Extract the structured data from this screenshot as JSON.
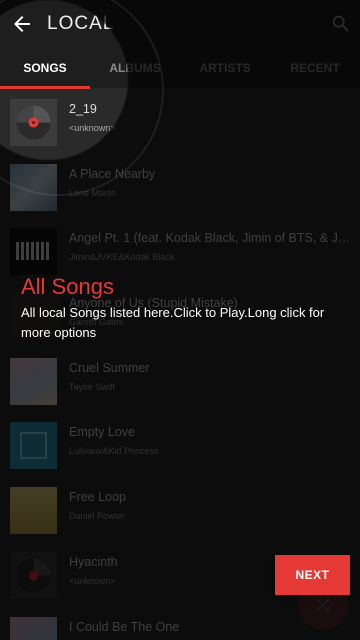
{
  "header": {
    "title": "LOCAL"
  },
  "tabs": [
    {
      "label": "SONGS"
    },
    {
      "label": "ALBUMS"
    },
    {
      "label": "ARTISTS"
    },
    {
      "label": "RECENT"
    }
  ],
  "songs": [
    {
      "title": "2_19",
      "artist": "<unknown>"
    },
    {
      "title": "A Place Nearby",
      "artist": "Lene Marlin"
    },
    {
      "title": "Angel Pt. 1 (feat. Kodak Black, Jimin of BTS, & JVKE...",
      "artist": "Jimin&JVKE&Kodak Black"
    },
    {
      "title": "Anyone of Us (Stupid Mistake)",
      "artist": "Gareth Gates"
    },
    {
      "title": "Cruel Summer",
      "artist": "Taylor Swift"
    },
    {
      "title": "Empty Love",
      "artist": "Lulleaux&Kid Princess"
    },
    {
      "title": "Free Loop",
      "artist": "Daniel Powter"
    },
    {
      "title": "Hyacinth",
      "artist": "<unknown>"
    },
    {
      "title": "I Could Be The One",
      "artist": ""
    }
  ],
  "guide": {
    "title": "All Songs",
    "description": "All local Songs listed here.Click to Play.Long click for more options",
    "next_label": "NEXT"
  },
  "colors": {
    "accent": "#e53935",
    "background": "#2a2a2a",
    "bar": "#1e1e1e"
  },
  "icons": {
    "back": "arrow-left-icon",
    "search": "search-icon",
    "shuffle": "shuffle-icon"
  }
}
